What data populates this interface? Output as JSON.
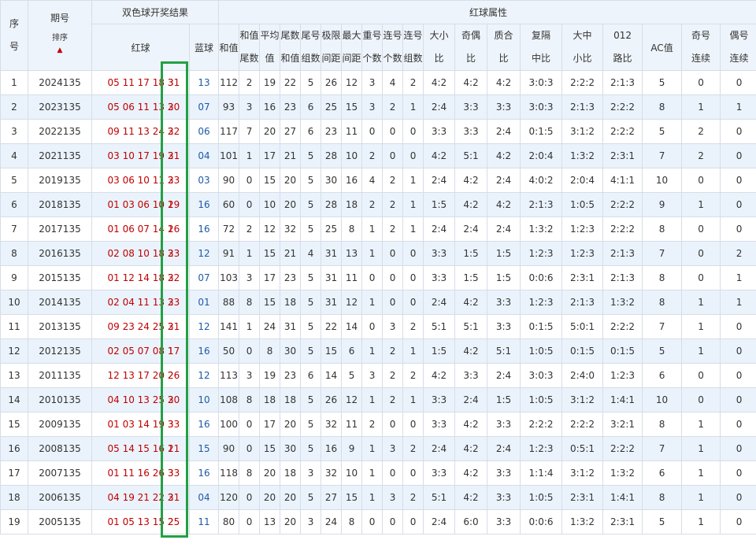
{
  "header": {
    "seq": [
      "序",
      "号"
    ],
    "period": "期号",
    "sort_label": "排序",
    "sort_icon": "sort-up-arrow",
    "draw_group": "双色球开奖结果",
    "red_ball": "红球",
    "blue_ball": "蓝球",
    "red_attr_group": "红球属性",
    "cols": [
      [
        "和值"
      ],
      [
        "和值",
        "尾数"
      ],
      [
        "平均",
        "值"
      ],
      [
        "尾数",
        "和值"
      ],
      [
        "尾号",
        "组数"
      ],
      [
        "极限",
        "间距"
      ],
      [
        "最大",
        "间距"
      ],
      [
        "重号",
        "个数"
      ],
      [
        "连号",
        "个数"
      ],
      [
        "连号",
        "组数"
      ],
      [
        "大小",
        "比"
      ],
      [
        "奇偶",
        "比"
      ],
      [
        "质合",
        "比"
      ],
      [
        "复隔",
        "中比"
      ],
      [
        "大中",
        "小比"
      ],
      [
        "012",
        "路比"
      ],
      [
        "AC值"
      ],
      [
        "奇号",
        "连续"
      ],
      [
        "偶号",
        "连续"
      ]
    ]
  },
  "colors": {
    "red_ball": "#c00000",
    "blue_ball": "#1e5aa8",
    "highlight": "#22a045",
    "row_alt": "#eaf3fc",
    "header_bg": "#eef4fb"
  },
  "rows": [
    {
      "seq": "1",
      "period": "2024135",
      "red": "05 11 17 18 3",
      "last": "31",
      "blue": "13",
      "v": [
        "112",
        "2",
        "19",
        "22",
        "5",
        "26",
        "12",
        "3",
        "4",
        "2",
        "4:2",
        "4:2",
        "4:2",
        "3:0:3",
        "2:2:2",
        "2:1:3",
        "5",
        "0",
        "0"
      ]
    },
    {
      "seq": "2",
      "period": "2023135",
      "red": "05 06 11 13 2",
      "last": "30",
      "blue": "07",
      "v": [
        "93",
        "3",
        "16",
        "23",
        "6",
        "25",
        "15",
        "3",
        "2",
        "1",
        "2:4",
        "3:3",
        "3:3",
        "3:0:3",
        "2:1:3",
        "2:2:2",
        "8",
        "1",
        "1"
      ]
    },
    {
      "seq": "3",
      "period": "2022135",
      "red": "09 11 13 24 2",
      "last": "32",
      "blue": "06",
      "v": [
        "117",
        "7",
        "20",
        "27",
        "6",
        "23",
        "11",
        "0",
        "0",
        "0",
        "3:3",
        "3:3",
        "2:4",
        "0:1:5",
        "3:1:2",
        "2:2:2",
        "5",
        "2",
        "0"
      ]
    },
    {
      "seq": "4",
      "period": "2021135",
      "red": "03 10 17 19 2",
      "last": "31",
      "blue": "04",
      "v": [
        "101",
        "1",
        "17",
        "21",
        "5",
        "28",
        "10",
        "2",
        "0",
        "0",
        "4:2",
        "5:1",
        "4:2",
        "2:0:4",
        "1:3:2",
        "2:3:1",
        "7",
        "2",
        "0"
      ]
    },
    {
      "seq": "5",
      "period": "2019135",
      "red": "03 06 10 11 2",
      "last": "33",
      "blue": "03",
      "v": [
        "90",
        "0",
        "15",
        "20",
        "5",
        "30",
        "16",
        "4",
        "2",
        "1",
        "2:4",
        "4:2",
        "2:4",
        "4:0:2",
        "2:0:4",
        "4:1:1",
        "10",
        "0",
        "0"
      ]
    },
    {
      "seq": "6",
      "period": "2018135",
      "red": "01 03 06 10 1",
      "last": "29",
      "blue": "16",
      "v": [
        "60",
        "0",
        "10",
        "20",
        "5",
        "28",
        "18",
        "2",
        "2",
        "1",
        "1:5",
        "4:2",
        "4:2",
        "2:1:3",
        "1:0:5",
        "2:2:2",
        "9",
        "1",
        "0"
      ]
    },
    {
      "seq": "7",
      "period": "2017135",
      "red": "01 06 07 14 1",
      "last": "26",
      "blue": "16",
      "v": [
        "72",
        "2",
        "12",
        "32",
        "5",
        "25",
        "8",
        "1",
        "2",
        "1",
        "2:4",
        "2:4",
        "2:4",
        "1:3:2",
        "1:2:3",
        "2:2:2",
        "8",
        "0",
        "0"
      ]
    },
    {
      "seq": "8",
      "period": "2016135",
      "red": "02 08 10 18 2",
      "last": "33",
      "blue": "12",
      "v": [
        "91",
        "1",
        "15",
        "21",
        "4",
        "31",
        "13",
        "1",
        "0",
        "0",
        "3:3",
        "1:5",
        "1:5",
        "1:2:3",
        "1:2:3",
        "2:1:3",
        "7",
        "0",
        "2"
      ]
    },
    {
      "seq": "9",
      "period": "2015135",
      "red": "01 12 14 18 2",
      "last": "32",
      "blue": "07",
      "v": [
        "103",
        "3",
        "17",
        "23",
        "5",
        "31",
        "11",
        "0",
        "0",
        "0",
        "3:3",
        "1:5",
        "1:5",
        "0:0:6",
        "2:3:1",
        "2:1:3",
        "8",
        "0",
        "1"
      ]
    },
    {
      "seq": "10",
      "period": "2014135",
      "red": "02 04 11 13 2",
      "last": "33",
      "blue": "01",
      "v": [
        "88",
        "8",
        "15",
        "18",
        "5",
        "31",
        "12",
        "1",
        "0",
        "0",
        "2:4",
        "4:2",
        "3:3",
        "1:2:3",
        "2:1:3",
        "1:3:2",
        "8",
        "1",
        "1"
      ]
    },
    {
      "seq": "11",
      "period": "2013135",
      "red": "09 23 24 25 2",
      "last": "31",
      "blue": "12",
      "v": [
        "141",
        "1",
        "24",
        "31",
        "5",
        "22",
        "14",
        "0",
        "3",
        "2",
        "5:1",
        "5:1",
        "3:3",
        "0:1:5",
        "5:0:1",
        "2:2:2",
        "7",
        "1",
        "0"
      ]
    },
    {
      "seq": "12",
      "period": "2012135",
      "red": "02 05 07 08 1",
      "last": "17",
      "blue": "16",
      "v": [
        "50",
        "0",
        "8",
        "30",
        "5",
        "15",
        "6",
        "1",
        "2",
        "1",
        "1:5",
        "4:2",
        "5:1",
        "1:0:5",
        "0:1:5",
        "0:1:5",
        "5",
        "1",
        "0"
      ]
    },
    {
      "seq": "13",
      "period": "2011135",
      "red": "12 13 17 20 2",
      "last": "26",
      "blue": "12",
      "v": [
        "113",
        "3",
        "19",
        "23",
        "6",
        "14",
        "5",
        "3",
        "2",
        "2",
        "4:2",
        "3:3",
        "2:4",
        "3:0:3",
        "2:4:0",
        "1:2:3",
        "6",
        "0",
        "0"
      ]
    },
    {
      "seq": "14",
      "period": "2010135",
      "red": "04 10 13 25 2",
      "last": "30",
      "blue": "10",
      "v": [
        "108",
        "8",
        "18",
        "18",
        "5",
        "26",
        "12",
        "1",
        "2",
        "1",
        "3:3",
        "2:4",
        "1:5",
        "1:0:5",
        "3:1:2",
        "1:4:1",
        "10",
        "0",
        "0"
      ]
    },
    {
      "seq": "15",
      "period": "2009135",
      "red": "01 03 14 19 3",
      "last": "33",
      "blue": "16",
      "v": [
        "100",
        "0",
        "17",
        "20",
        "5",
        "32",
        "11",
        "2",
        "0",
        "0",
        "3:3",
        "4:2",
        "3:3",
        "2:2:2",
        "2:2:2",
        "3:2:1",
        "8",
        "1",
        "0"
      ]
    },
    {
      "seq": "16",
      "period": "2008135",
      "red": "05 14 15 16 1",
      "last": "21",
      "blue": "15",
      "v": [
        "90",
        "0",
        "15",
        "30",
        "5",
        "16",
        "9",
        "1",
        "3",
        "2",
        "2:4",
        "4:2",
        "2:4",
        "1:2:3",
        "0:5:1",
        "2:2:2",
        "7",
        "1",
        "0"
      ]
    },
    {
      "seq": "17",
      "period": "2007135",
      "red": "01 11 16 26 3",
      "last": "33",
      "blue": "16",
      "v": [
        "118",
        "8",
        "20",
        "18",
        "3",
        "32",
        "10",
        "1",
        "0",
        "0",
        "3:3",
        "4:2",
        "3:3",
        "1:1:4",
        "3:1:2",
        "1:3:2",
        "6",
        "1",
        "0"
      ]
    },
    {
      "seq": "18",
      "period": "2006135",
      "red": "04 19 21 22 2",
      "last": "31",
      "blue": "04",
      "v": [
        "120",
        "0",
        "20",
        "20",
        "5",
        "27",
        "15",
        "1",
        "3",
        "2",
        "5:1",
        "4:2",
        "3:3",
        "1:0:5",
        "2:3:1",
        "1:4:1",
        "8",
        "1",
        "0"
      ]
    },
    {
      "seq": "19",
      "period": "2005135",
      "red": "01 05 13 15 2",
      "last": "25",
      "blue": "11",
      "v": [
        "80",
        "0",
        "13",
        "20",
        "3",
        "24",
        "8",
        "0",
        "0",
        "0",
        "2:4",
        "6:0",
        "3:3",
        "0:0:6",
        "1:3:2",
        "2:3:1",
        "5",
        "1",
        "0"
      ]
    }
  ]
}
